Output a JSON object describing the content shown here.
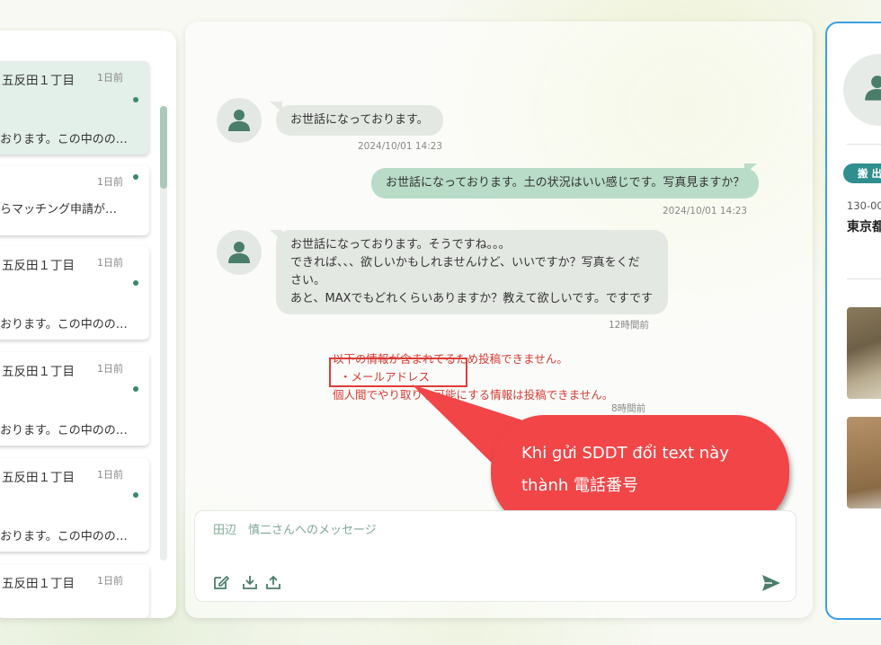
{
  "conversations": [
    {
      "title": "五反田１丁目",
      "time": "1日前",
      "preview": "おります。この中のの…"
    },
    {
      "title": "",
      "time": "1日前",
      "preview": "らマッチング申請が…"
    },
    {
      "title": "五反田１丁目",
      "time": "1日前",
      "preview": "おります。この中のの…"
    },
    {
      "title": "五反田１丁目",
      "time": "1日前",
      "preview": "おります。この中のの…"
    },
    {
      "title": "五反田１丁目",
      "time": "1日前",
      "preview": "おります。この中のの…"
    },
    {
      "title": "五反田１丁目",
      "time": "1日前",
      "preview": ""
    }
  ],
  "messages": [
    {
      "text": "お世話になっております。",
      "time": "2024/10/01 14:23"
    },
    {
      "text": "お世話になっております。土の状況はいい感じです。写真見ますか？",
      "time": "2024/10/01 14:23"
    },
    {
      "lines": [
        "お世話になっております。そうですね。。。",
        "できれば、、、欲しいかもしれませんけど、いいですか？写真をくだ",
        "さい。",
        "あと、MAXでもどれくらいありますか？教えて欲しいです。ですです"
      ],
      "time": "12時間前"
    }
  ],
  "warning": {
    "line1": "以下の情報が含まれてるため投稿できません。",
    "line2": "・メールアドレス",
    "line3": "個人間でやり取りを可能にする情報は投稿できません。",
    "time": "8時間前"
  },
  "callout": {
    "line1": "Khi gửi SDDT đổi text này",
    "line2": "thành 電話番号"
  },
  "composer": {
    "placeholder": "田辺　慎二さんへのメッセージ",
    "icons": [
      "edit-icon",
      "download-icon",
      "upload-icon",
      "send-icon"
    ]
  },
  "right_panel": {
    "badge": "搬 出",
    "zip": "130-00",
    "address": "東京都"
  },
  "colors": {
    "accent": "#3b8a6a",
    "my_bubble": "#b8dcc7",
    "their_bubble": "#e4e8e3",
    "warning": "#d63a35",
    "callout": "#f24547",
    "badge": "#2f8f8f",
    "right_border": "#3a9fe6"
  }
}
